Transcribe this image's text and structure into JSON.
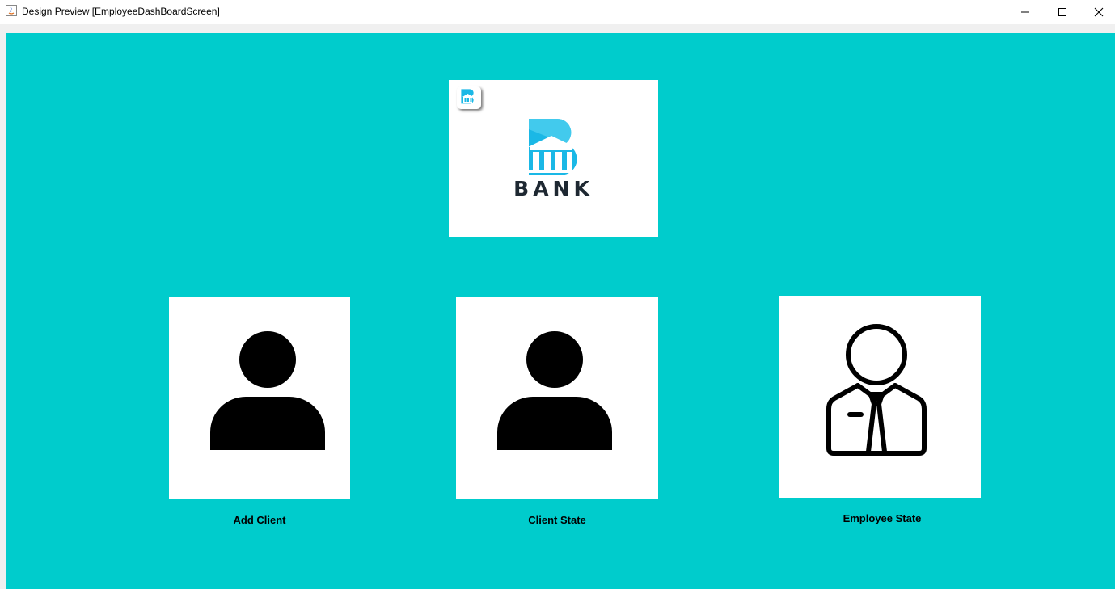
{
  "window": {
    "title": "Design Preview [EmployeeDashBoardScreen]",
    "controls": [
      "minimize-icon",
      "maximize-icon",
      "close-icon"
    ]
  },
  "logo": {
    "word": "BANK",
    "icon": "bank-building-icon",
    "brand_color": "#1ab8e6"
  },
  "background_color": "#00cccc",
  "cards": [
    {
      "label": "Add Client",
      "icon": "user-silhouette-icon"
    },
    {
      "label": "Client State",
      "icon": "user-silhouette-icon"
    },
    {
      "label": "Employee State",
      "icon": "employee-tie-icon"
    }
  ]
}
